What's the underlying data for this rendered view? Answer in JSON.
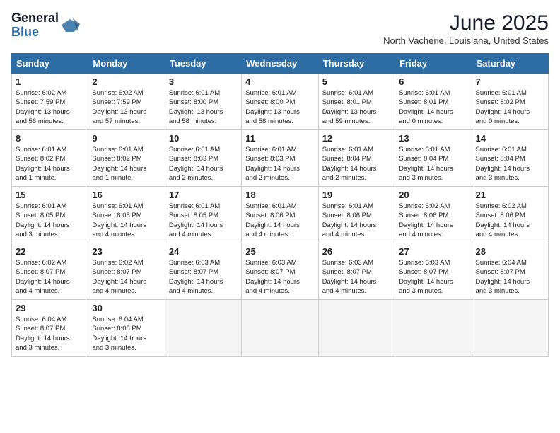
{
  "header": {
    "logo_line1": "General",
    "logo_line2": "Blue",
    "title": "June 2025",
    "location": "North Vacherie, Louisiana, United States"
  },
  "calendar": {
    "weekdays": [
      "Sunday",
      "Monday",
      "Tuesday",
      "Wednesday",
      "Thursday",
      "Friday",
      "Saturday"
    ],
    "weeks": [
      [
        {
          "day": "",
          "info": ""
        },
        {
          "day": "2",
          "info": "Sunrise: 6:02 AM\nSunset: 7:59 PM\nDaylight: 13 hours\nand 57 minutes."
        },
        {
          "day": "3",
          "info": "Sunrise: 6:01 AM\nSunset: 8:00 PM\nDaylight: 13 hours\nand 58 minutes."
        },
        {
          "day": "4",
          "info": "Sunrise: 6:01 AM\nSunset: 8:00 PM\nDaylight: 13 hours\nand 58 minutes."
        },
        {
          "day": "5",
          "info": "Sunrise: 6:01 AM\nSunset: 8:01 PM\nDaylight: 13 hours\nand 59 minutes."
        },
        {
          "day": "6",
          "info": "Sunrise: 6:01 AM\nSunset: 8:01 PM\nDaylight: 14 hours\nand 0 minutes."
        },
        {
          "day": "7",
          "info": "Sunrise: 6:01 AM\nSunset: 8:02 PM\nDaylight: 14 hours\nand 0 minutes."
        }
      ],
      [
        {
          "day": "1",
          "info": "Sunrise: 6:02 AM\nSunset: 7:59 PM\nDaylight: 13 hours\nand 56 minutes."
        },
        {
          "day": "9",
          "info": "Sunrise: 6:01 AM\nSunset: 8:02 PM\nDaylight: 14 hours\nand 1 minute."
        },
        {
          "day": "10",
          "info": "Sunrise: 6:01 AM\nSunset: 8:03 PM\nDaylight: 14 hours\nand 2 minutes."
        },
        {
          "day": "11",
          "info": "Sunrise: 6:01 AM\nSunset: 8:03 PM\nDaylight: 14 hours\nand 2 minutes."
        },
        {
          "day": "12",
          "info": "Sunrise: 6:01 AM\nSunset: 8:04 PM\nDaylight: 14 hours\nand 2 minutes."
        },
        {
          "day": "13",
          "info": "Sunrise: 6:01 AM\nSunset: 8:04 PM\nDaylight: 14 hours\nand 3 minutes."
        },
        {
          "day": "14",
          "info": "Sunrise: 6:01 AM\nSunset: 8:04 PM\nDaylight: 14 hours\nand 3 minutes."
        }
      ],
      [
        {
          "day": "8",
          "info": "Sunrise: 6:01 AM\nSunset: 8:02 PM\nDaylight: 14 hours\nand 1 minute."
        },
        {
          "day": "16",
          "info": "Sunrise: 6:01 AM\nSunset: 8:05 PM\nDaylight: 14 hours\nand 4 minutes."
        },
        {
          "day": "17",
          "info": "Sunrise: 6:01 AM\nSunset: 8:05 PM\nDaylight: 14 hours\nand 4 minutes."
        },
        {
          "day": "18",
          "info": "Sunrise: 6:01 AM\nSunset: 8:06 PM\nDaylight: 14 hours\nand 4 minutes."
        },
        {
          "day": "19",
          "info": "Sunrise: 6:01 AM\nSunset: 8:06 PM\nDaylight: 14 hours\nand 4 minutes."
        },
        {
          "day": "20",
          "info": "Sunrise: 6:02 AM\nSunset: 8:06 PM\nDaylight: 14 hours\nand 4 minutes."
        },
        {
          "day": "21",
          "info": "Sunrise: 6:02 AM\nSunset: 8:06 PM\nDaylight: 14 hours\nand 4 minutes."
        }
      ],
      [
        {
          "day": "15",
          "info": "Sunrise: 6:01 AM\nSunset: 8:05 PM\nDaylight: 14 hours\nand 3 minutes."
        },
        {
          "day": "23",
          "info": "Sunrise: 6:02 AM\nSunset: 8:07 PM\nDaylight: 14 hours\nand 4 minutes."
        },
        {
          "day": "24",
          "info": "Sunrise: 6:03 AM\nSunset: 8:07 PM\nDaylight: 14 hours\nand 4 minutes."
        },
        {
          "day": "25",
          "info": "Sunrise: 6:03 AM\nSunset: 8:07 PM\nDaylight: 14 hours\nand 4 minutes."
        },
        {
          "day": "26",
          "info": "Sunrise: 6:03 AM\nSunset: 8:07 PM\nDaylight: 14 hours\nand 4 minutes."
        },
        {
          "day": "27",
          "info": "Sunrise: 6:03 AM\nSunset: 8:07 PM\nDaylight: 14 hours\nand 3 minutes."
        },
        {
          "day": "28",
          "info": "Sunrise: 6:04 AM\nSunset: 8:07 PM\nDaylight: 14 hours\nand 3 minutes."
        }
      ],
      [
        {
          "day": "22",
          "info": "Sunrise: 6:02 AM\nSunset: 8:07 PM\nDaylight: 14 hours\nand 4 minutes."
        },
        {
          "day": "30",
          "info": "Sunrise: 6:04 AM\nSunset: 8:08 PM\nDaylight: 14 hours\nand 3 minutes."
        },
        {
          "day": "",
          "info": ""
        },
        {
          "day": "",
          "info": ""
        },
        {
          "day": "",
          "info": ""
        },
        {
          "day": "",
          "info": ""
        },
        {
          "day": "",
          "info": ""
        }
      ],
      [
        {
          "day": "29",
          "info": "Sunrise: 6:04 AM\nSunset: 8:07 PM\nDaylight: 14 hours\nand 3 minutes."
        },
        {
          "day": "",
          "info": ""
        },
        {
          "day": "",
          "info": ""
        },
        {
          "day": "",
          "info": ""
        },
        {
          "day": "",
          "info": ""
        },
        {
          "day": "",
          "info": ""
        },
        {
          "day": "",
          "info": ""
        }
      ]
    ]
  }
}
